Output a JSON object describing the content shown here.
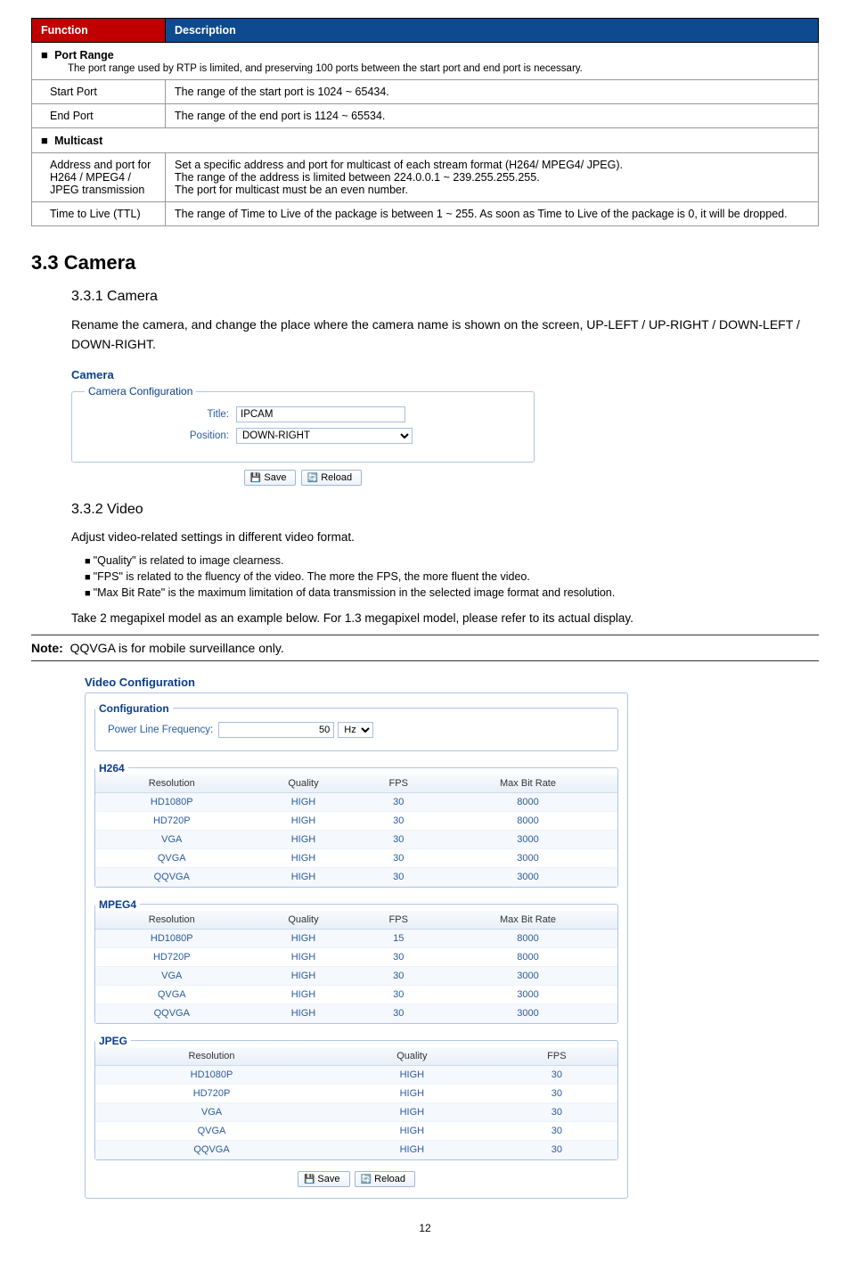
{
  "func_table": {
    "headers": [
      "Function",
      "Description"
    ],
    "port_range_title": "Port Range",
    "port_range_desc": "The port range used by RTP is limited, and preserving 100 ports between the start port and end port is necessary.",
    "rows1": [
      [
        "Start Port",
        "The range of the start port is 1024 ~ 65434."
      ],
      [
        "End Port",
        "The range of the end port is 1124 ~ 65534."
      ]
    ],
    "multicast_title": "Multicast",
    "rows2": [
      [
        "Address and port for H264 / MPEG4 / JPEG transmission",
        "Set a specific address and port for multicast of each stream format (H264/ MPEG4/ JPEG).\nThe range of the address is limited between 224.0.0.1 ~ 239.255.255.255.\nThe port for multicast must be an even number."
      ],
      [
        "Time to Live (TTL)",
        "The range of Time to Live of the package is between 1 ~ 255. As soon as Time to Live of the package is 0, it will be dropped."
      ]
    ]
  },
  "section": {
    "camera_h": "3.3 Camera",
    "camera_sub1": "3.3.1 Camera",
    "camera_p": "Rename the camera, and change the place where the camera name is shown on the screen, UP-LEFT / UP-RIGHT / DOWN-LEFT / DOWN-RIGHT.",
    "video_sub": "3.3.2 Video",
    "video_p": "Adjust video-related settings in different video format.",
    "bullets": [
      "\"Quality\" is related to image clearness.",
      "\"FPS\" is related to the fluency of the video. The more the FPS, the more fluent the video.",
      "\"Max Bit Rate\" is the maximum limitation of data transmission in the selected image format and resolution."
    ],
    "video_p2": "Take 2 megapixel model as an example below. For 1.3 megapixel model, please refer to its actual display.",
    "note_label": "Note:",
    "note_text": "QQVGA is for mobile surveillance only."
  },
  "camera_panel": {
    "title": "Camera",
    "legend": "Camera Configuration",
    "title_label": "Title:",
    "title_value": "IPCAM",
    "position_label": "Position:",
    "position_value": "DOWN-RIGHT",
    "save": "Save",
    "reload": "Reload"
  },
  "video_panel": {
    "title": "Video Configuration",
    "legend_config": "Configuration",
    "pl_label": "Power Line Frequency:",
    "pl_value": "50",
    "pl_unit": "Hz",
    "groups": [
      {
        "legend": "H264",
        "headers": [
          "Resolution",
          "Quality",
          "FPS",
          "Max Bit Rate"
        ],
        "rows": [
          [
            "HD1080P",
            "HIGH",
            "30",
            "8000"
          ],
          [
            "HD720P",
            "HIGH",
            "30",
            "8000"
          ],
          [
            "VGA",
            "HIGH",
            "30",
            "3000"
          ],
          [
            "QVGA",
            "HIGH",
            "30",
            "3000"
          ],
          [
            "QQVGA",
            "HIGH",
            "30",
            "3000"
          ]
        ]
      },
      {
        "legend": "MPEG4",
        "headers": [
          "Resolution",
          "Quality",
          "FPS",
          "Max Bit Rate"
        ],
        "rows": [
          [
            "HD1080P",
            "HIGH",
            "15",
            "8000"
          ],
          [
            "HD720P",
            "HIGH",
            "30",
            "8000"
          ],
          [
            "VGA",
            "HIGH",
            "30",
            "3000"
          ],
          [
            "QVGA",
            "HIGH",
            "30",
            "3000"
          ],
          [
            "QQVGA",
            "HIGH",
            "30",
            "3000"
          ]
        ]
      },
      {
        "legend": "JPEG",
        "headers": [
          "Resolution",
          "Quality",
          "FPS"
        ],
        "rows": [
          [
            "HD1080P",
            "HIGH",
            "30"
          ],
          [
            "HD720P",
            "HIGH",
            "30"
          ],
          [
            "VGA",
            "HIGH",
            "30"
          ],
          [
            "QVGA",
            "HIGH",
            "30"
          ],
          [
            "QQVGA",
            "HIGH",
            "30"
          ]
        ]
      }
    ],
    "save": "Save",
    "reload": "Reload"
  },
  "page_number": "12"
}
